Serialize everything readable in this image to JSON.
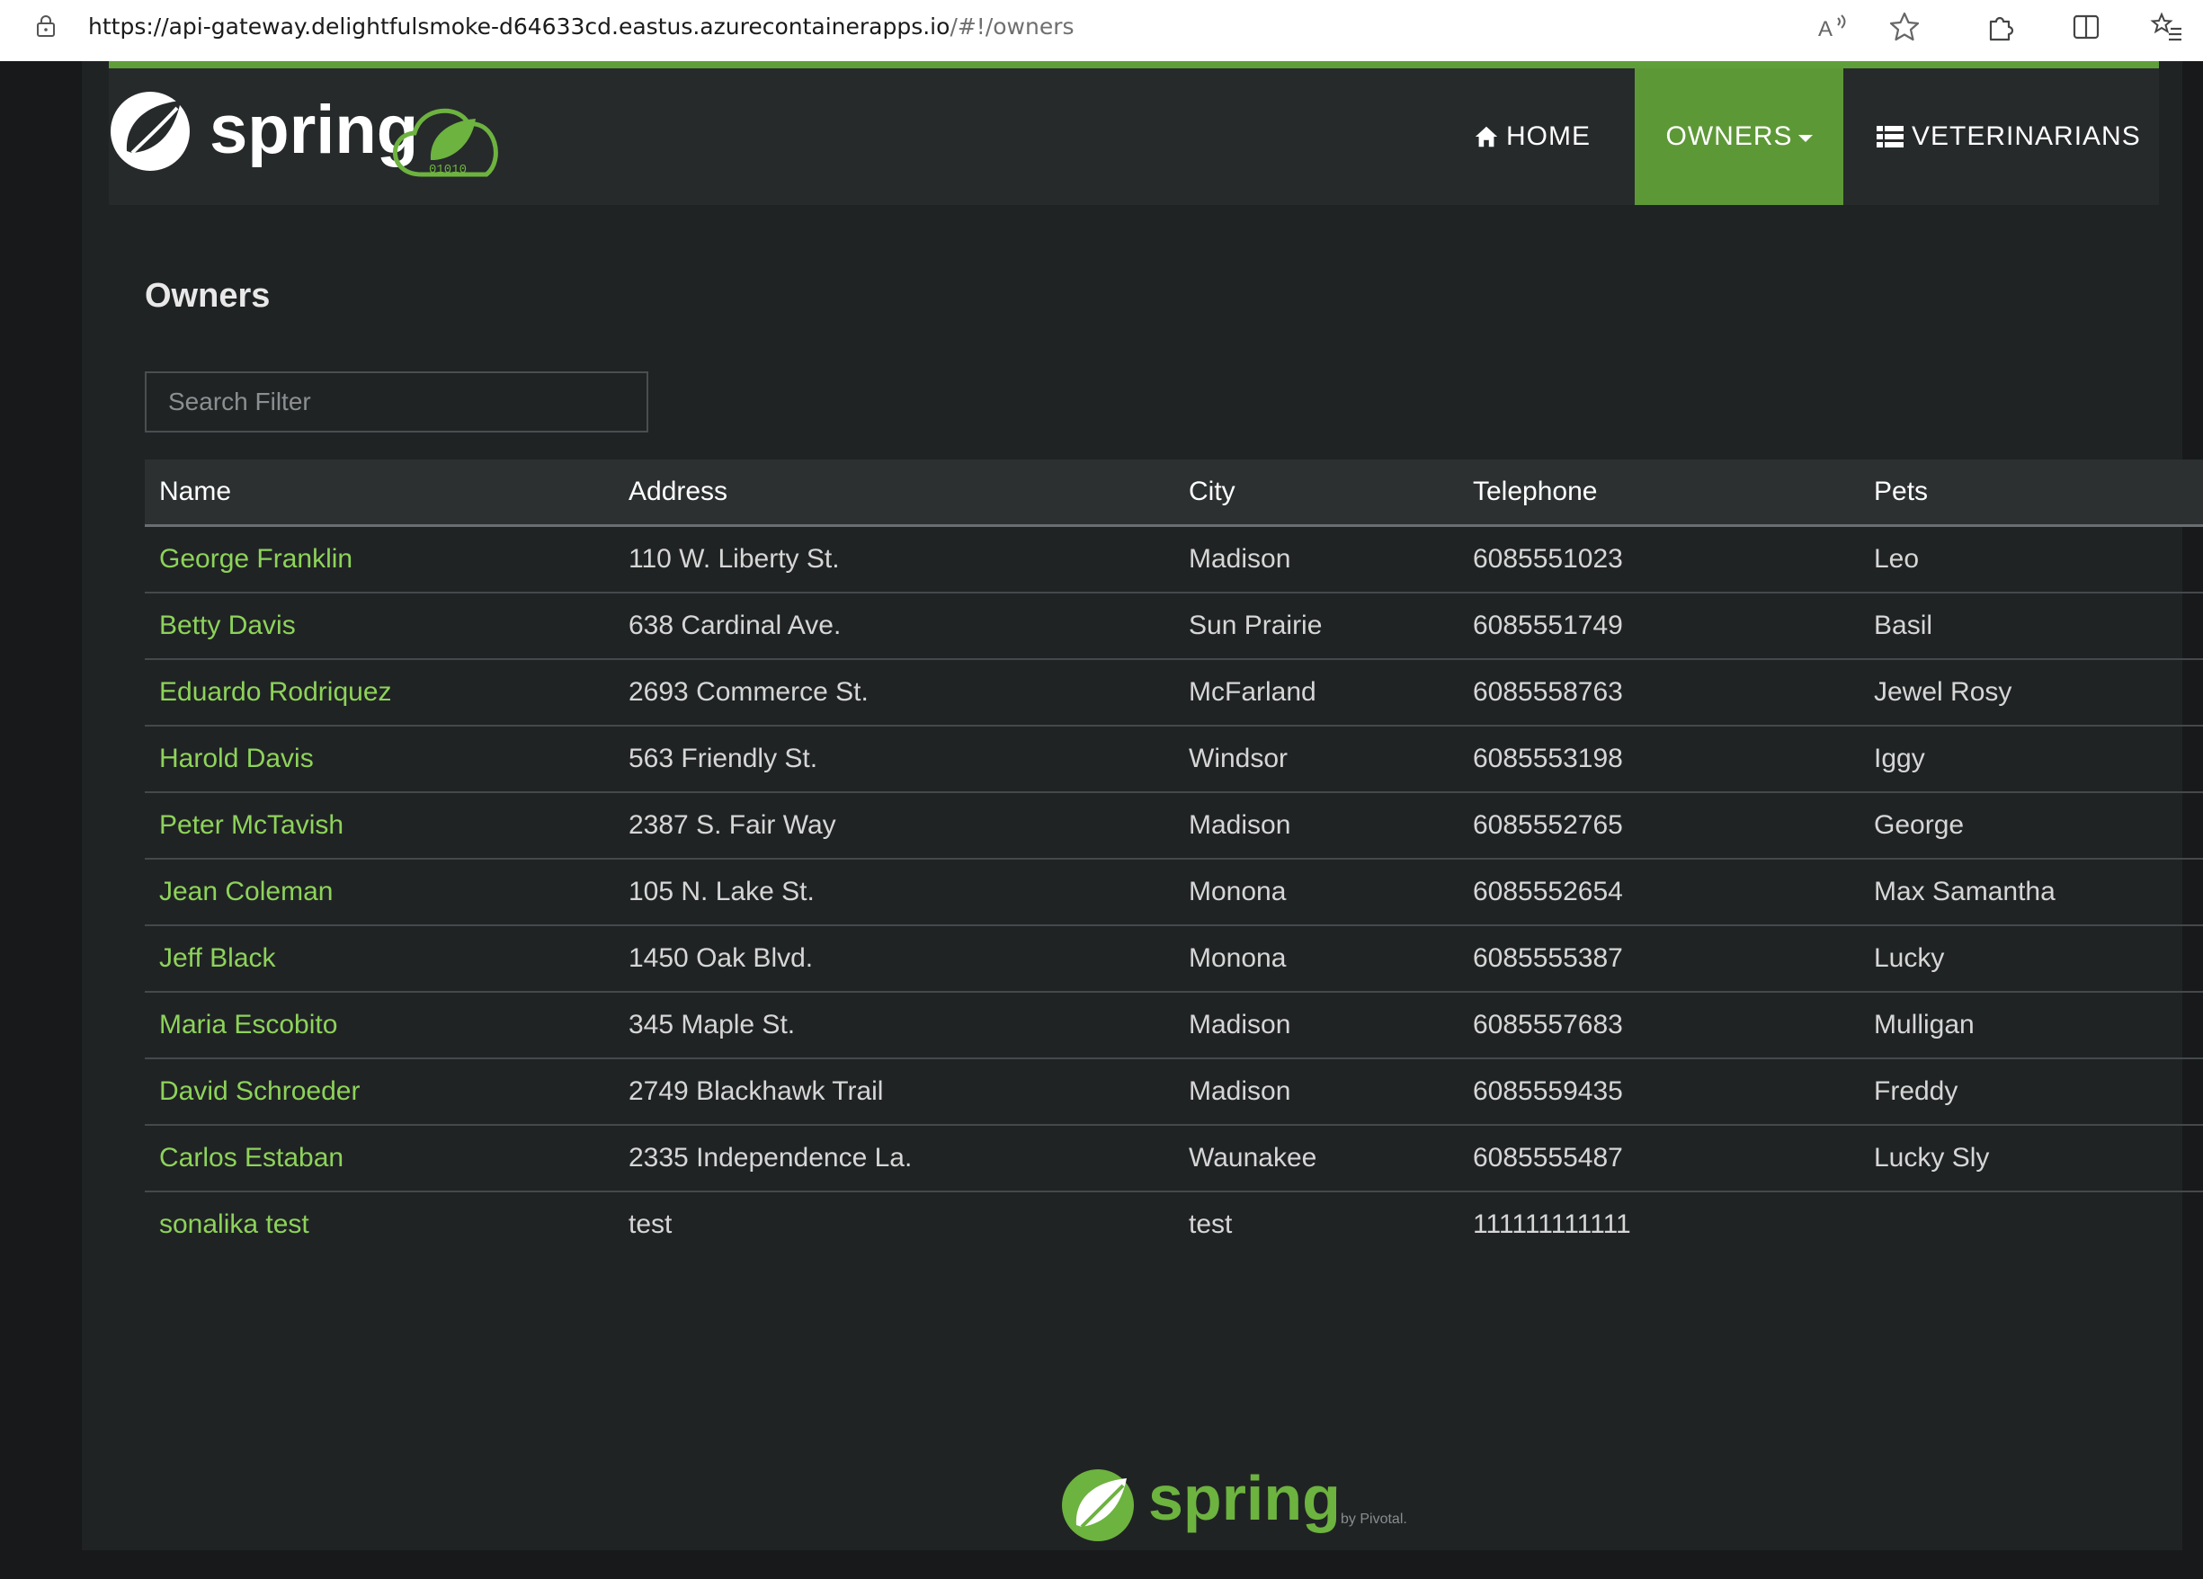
{
  "browser": {
    "url_host": "https://api-gateway.delightfulsmoke-d64633cd.eastus.azurecontainerapps.io",
    "url_path": "/#!/owners",
    "icons": [
      "lock-icon",
      "read-aloud-icon",
      "favorite-star-icon",
      "extensions-icon",
      "split-screen-icon",
      "favorites-list-icon"
    ]
  },
  "navbar": {
    "logo_text": "spring",
    "logo_badge": "01010",
    "home": "HOME",
    "owners": "OWNERS",
    "vets": "VETERINARIANS",
    "active_color": "#5d9837"
  },
  "page": {
    "title": "Owners",
    "search_placeholder": "Search Filter"
  },
  "table": {
    "headers": [
      "Name",
      "Address",
      "City",
      "Telephone",
      "Pets"
    ],
    "rows": [
      [
        "George Franklin",
        "110 W. Liberty St.",
        "Madison",
        "6085551023",
        "Leo"
      ],
      [
        "Betty Davis",
        "638 Cardinal Ave.",
        "Sun Prairie",
        "6085551749",
        "Basil"
      ],
      [
        "Eduardo Rodriquez",
        "2693 Commerce St.",
        "McFarland",
        "6085558763",
        "Jewel Rosy"
      ],
      [
        "Harold Davis",
        "563 Friendly St.",
        "Windsor",
        "6085553198",
        "Iggy"
      ],
      [
        "Peter McTavish",
        "2387 S. Fair Way",
        "Madison",
        "6085552765",
        "George"
      ],
      [
        "Jean Coleman",
        "105 N. Lake St.",
        "Monona",
        "6085552654",
        "Max Samantha"
      ],
      [
        "Jeff Black",
        "1450 Oak Blvd.",
        "Monona",
        "6085555387",
        "Lucky"
      ],
      [
        "Maria Escobito",
        "345 Maple St.",
        "Madison",
        "6085557683",
        "Mulligan"
      ],
      [
        "David Schroeder",
        "2749 Blackhawk Trail",
        "Madison",
        "6085559435",
        "Freddy"
      ],
      [
        "Carlos Estaban",
        "2335 Independence La.",
        "Waunakee",
        "6085555487",
        "Lucky Sly"
      ],
      [
        "sonalika test",
        "test",
        "test",
        "111111111111",
        ""
      ]
    ]
  },
  "footer": {
    "logo_text": "spring",
    "byline": "by Pivotal."
  }
}
